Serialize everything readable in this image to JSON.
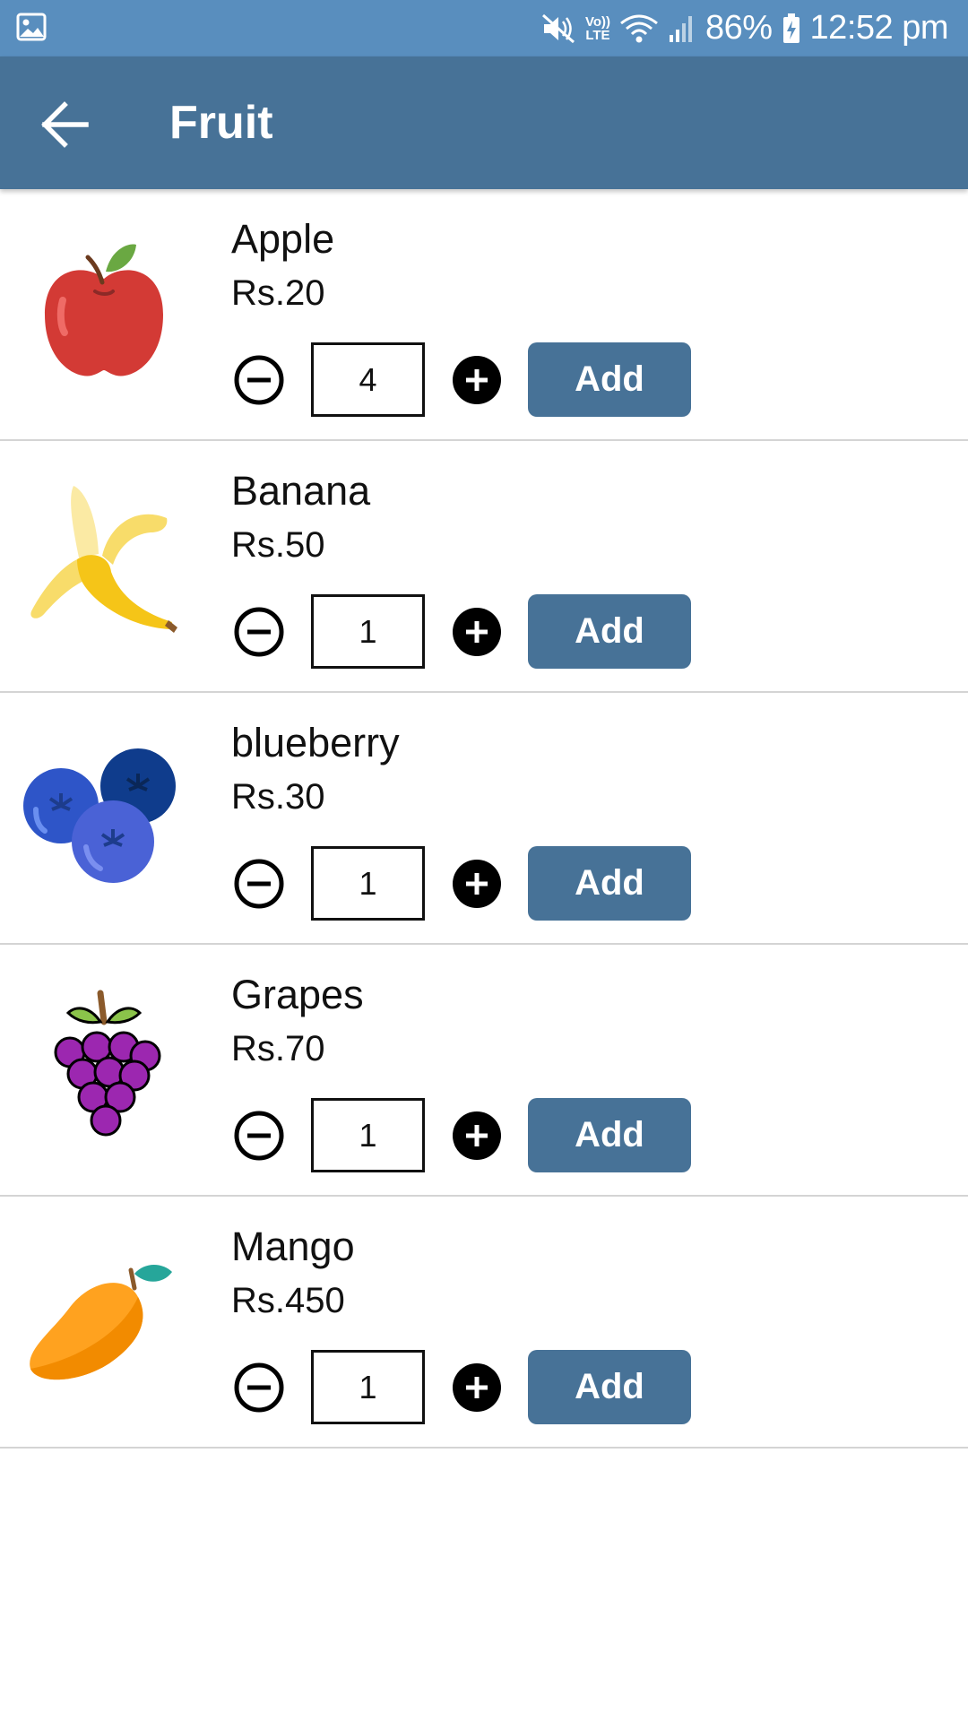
{
  "status_bar": {
    "battery": "86%",
    "time": "12:52 pm",
    "volte_line1": "Vo))",
    "volte_line2": "LTE",
    "icons": [
      "gallery-icon",
      "mute-icon",
      "volte-icon",
      "wifi-icon",
      "signal-icon",
      "battery-icon"
    ]
  },
  "app_bar": {
    "title": "Fruit",
    "back_icon": "arrow-back-icon"
  },
  "colors": {
    "status_bar": "#598ebe",
    "app_bar": "#477297",
    "button": "#477297"
  },
  "products": [
    {
      "name": "Apple",
      "price": "Rs.20",
      "quantity": "4",
      "add_label": "Add",
      "image_icon": "apple-icon"
    },
    {
      "name": "Banana",
      "price": "Rs.50",
      "quantity": "1",
      "add_label": "Add",
      "image_icon": "banana-icon"
    },
    {
      "name": "blueberry",
      "price": "Rs.30",
      "quantity": "1",
      "add_label": "Add",
      "image_icon": "blueberry-icon"
    },
    {
      "name": "Grapes",
      "price": "Rs.70",
      "quantity": "1",
      "add_label": "Add",
      "image_icon": "grapes-icon"
    },
    {
      "name": "Mango",
      "price": "Rs.450",
      "quantity": "1",
      "add_label": "Add",
      "image_icon": "mango-icon"
    }
  ]
}
